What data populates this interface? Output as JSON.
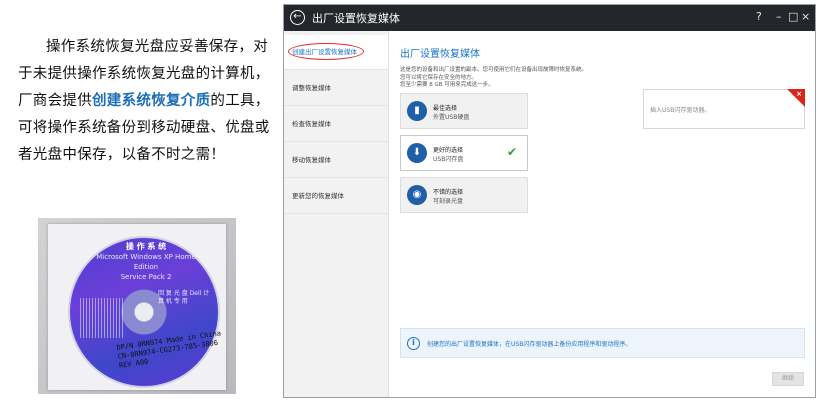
{
  "doc": {
    "paragraph_pre": "操作系统恢复光盘应妥善保存，对于未提供操作系统恢复光盘的计算机，厂商会提供",
    "paragraph_highlight": "创建系统恢复介质",
    "paragraph_post": "的工具，可将操作系统备份到移动硬盘、优盘或者光盘中保存，以备不时之需！",
    "highlight_color": "#1f6fb6"
  },
  "disc_photo": {
    "header_line1": "操 作 系 统",
    "header_line2": "Microsoft Windows XP Home Edition",
    "header_line3": "Service Pack 2",
    "side_text": "回 复 光 盘 Dell 计 算 机 专 用",
    "label_line1": "DP/N 0RN974    Made in China",
    "label_line2": "CN-0RN974-CG273-785-3806",
    "label_line3": "REV A00"
  },
  "app": {
    "title": "出厂设置恢复媒体",
    "window_controls": {
      "help": "?",
      "minimize": "–",
      "maximize": "□",
      "close": "×"
    },
    "sidebar": {
      "items": [
        {
          "label": "创建出厂设置恢复媒体",
          "active": true
        },
        {
          "label": "调整恢复媒体",
          "active": false
        },
        {
          "label": "检查恢复媒体",
          "active": false
        },
        {
          "label": "移动恢复媒体",
          "active": false
        },
        {
          "label": "更新您的恢复媒体",
          "active": false
        }
      ]
    },
    "main": {
      "heading": "出厂设置恢复媒体",
      "description_lines": [
        "这是您的设备和出厂设置的副本。您可使用它们在设备出现故障时恢复系统。",
        "您可以将它保存在安全的地方。",
        "您至少需要 8 GB 可用来完成这一步。"
      ],
      "options": [
        {
          "title": "最佳选择",
          "subtitle": "外置USB硬盘",
          "icon": "hdd-icon"
        },
        {
          "title": "更好的选择",
          "subtitle": "USB闪存盘",
          "icon": "usb-icon",
          "selected": true
        },
        {
          "title": "不错的选择",
          "subtitle": "可刻录光盘",
          "icon": "disc-icon"
        }
      ],
      "usb_hint": "插入USB闪存驱动器。",
      "info_text": "创建您的出厂设置恢复媒体，在USB闪存驱动器上备份应用程序和驱动程序。",
      "next_label": "继续"
    },
    "colors": {
      "accent": "#1a73c9",
      "titlebar": "#23262b",
      "error": "#d9261c",
      "check": "#2e9b3c"
    }
  }
}
